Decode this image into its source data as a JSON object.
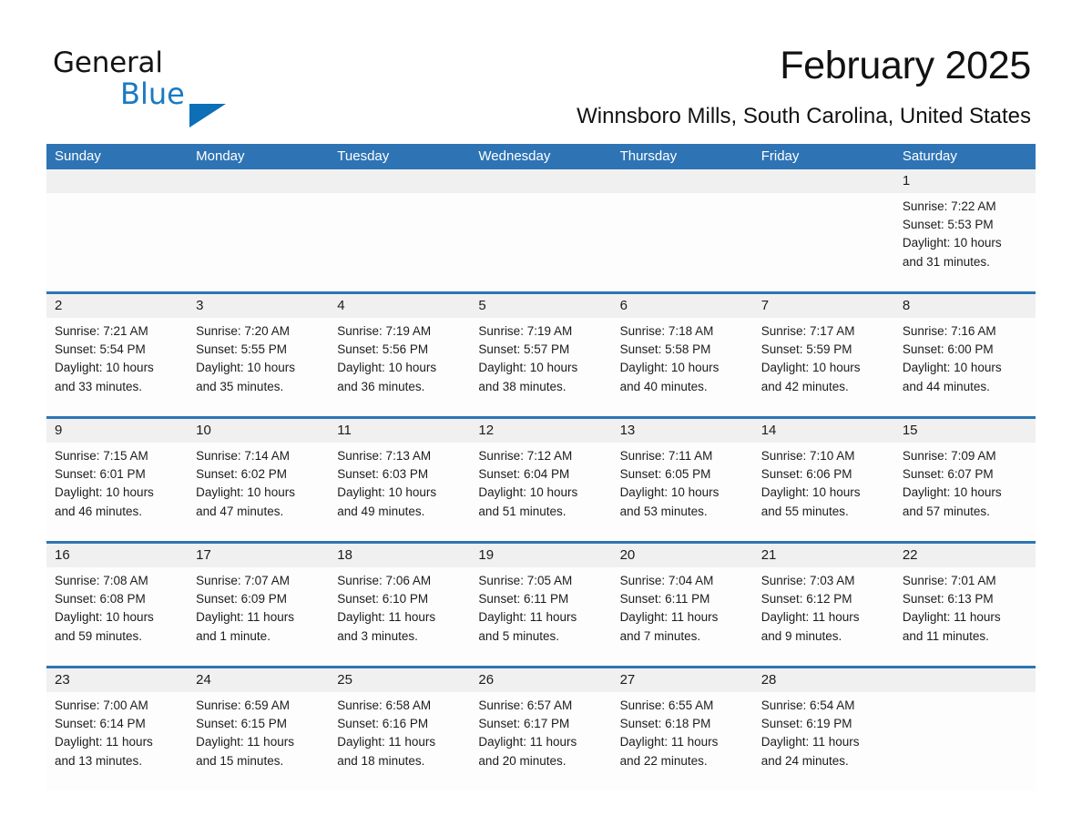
{
  "logo": {
    "line1": "General",
    "line2": "Blue",
    "triangle_color": "#0c6fb8",
    "line2_color": "#1a7ac4"
  },
  "header": {
    "title": "February 2025",
    "subtitle": "Winnsboro Mills, South Carolina, United States"
  },
  "theme": {
    "header_blue": "#2e74b5",
    "daynum_band": "#f0f0f0",
    "text": "#1c1c1c"
  },
  "weekdays": [
    "Sunday",
    "Monday",
    "Tuesday",
    "Wednesday",
    "Thursday",
    "Friday",
    "Saturday"
  ],
  "weeks": [
    [
      {
        "day": "",
        "sunrise": "",
        "sunset": "",
        "daylight_line1": "",
        "daylight_line2": ""
      },
      {
        "day": "",
        "sunrise": "",
        "sunset": "",
        "daylight_line1": "",
        "daylight_line2": ""
      },
      {
        "day": "",
        "sunrise": "",
        "sunset": "",
        "daylight_line1": "",
        "daylight_line2": ""
      },
      {
        "day": "",
        "sunrise": "",
        "sunset": "",
        "daylight_line1": "",
        "daylight_line2": ""
      },
      {
        "day": "",
        "sunrise": "",
        "sunset": "",
        "daylight_line1": "",
        "daylight_line2": ""
      },
      {
        "day": "",
        "sunrise": "",
        "sunset": "",
        "daylight_line1": "",
        "daylight_line2": ""
      },
      {
        "day": "1",
        "sunrise": "Sunrise: 7:22 AM",
        "sunset": "Sunset: 5:53 PM",
        "daylight_line1": "Daylight: 10 hours",
        "daylight_line2": "and 31 minutes."
      }
    ],
    [
      {
        "day": "2",
        "sunrise": "Sunrise: 7:21 AM",
        "sunset": "Sunset: 5:54 PM",
        "daylight_line1": "Daylight: 10 hours",
        "daylight_line2": "and 33 minutes."
      },
      {
        "day": "3",
        "sunrise": "Sunrise: 7:20 AM",
        "sunset": "Sunset: 5:55 PM",
        "daylight_line1": "Daylight: 10 hours",
        "daylight_line2": "and 35 minutes."
      },
      {
        "day": "4",
        "sunrise": "Sunrise: 7:19 AM",
        "sunset": "Sunset: 5:56 PM",
        "daylight_line1": "Daylight: 10 hours",
        "daylight_line2": "and 36 minutes."
      },
      {
        "day": "5",
        "sunrise": "Sunrise: 7:19 AM",
        "sunset": "Sunset: 5:57 PM",
        "daylight_line1": "Daylight: 10 hours",
        "daylight_line2": "and 38 minutes."
      },
      {
        "day": "6",
        "sunrise": "Sunrise: 7:18 AM",
        "sunset": "Sunset: 5:58 PM",
        "daylight_line1": "Daylight: 10 hours",
        "daylight_line2": "and 40 minutes."
      },
      {
        "day": "7",
        "sunrise": "Sunrise: 7:17 AM",
        "sunset": "Sunset: 5:59 PM",
        "daylight_line1": "Daylight: 10 hours",
        "daylight_line2": "and 42 minutes."
      },
      {
        "day": "8",
        "sunrise": "Sunrise: 7:16 AM",
        "sunset": "Sunset: 6:00 PM",
        "daylight_line1": "Daylight: 10 hours",
        "daylight_line2": "and 44 minutes."
      }
    ],
    [
      {
        "day": "9",
        "sunrise": "Sunrise: 7:15 AM",
        "sunset": "Sunset: 6:01 PM",
        "daylight_line1": "Daylight: 10 hours",
        "daylight_line2": "and 46 minutes."
      },
      {
        "day": "10",
        "sunrise": "Sunrise: 7:14 AM",
        "sunset": "Sunset: 6:02 PM",
        "daylight_line1": "Daylight: 10 hours",
        "daylight_line2": "and 47 minutes."
      },
      {
        "day": "11",
        "sunrise": "Sunrise: 7:13 AM",
        "sunset": "Sunset: 6:03 PM",
        "daylight_line1": "Daylight: 10 hours",
        "daylight_line2": "and 49 minutes."
      },
      {
        "day": "12",
        "sunrise": "Sunrise: 7:12 AM",
        "sunset": "Sunset: 6:04 PM",
        "daylight_line1": "Daylight: 10 hours",
        "daylight_line2": "and 51 minutes."
      },
      {
        "day": "13",
        "sunrise": "Sunrise: 7:11 AM",
        "sunset": "Sunset: 6:05 PM",
        "daylight_line1": "Daylight: 10 hours",
        "daylight_line2": "and 53 minutes."
      },
      {
        "day": "14",
        "sunrise": "Sunrise: 7:10 AM",
        "sunset": "Sunset: 6:06 PM",
        "daylight_line1": "Daylight: 10 hours",
        "daylight_line2": "and 55 minutes."
      },
      {
        "day": "15",
        "sunrise": "Sunrise: 7:09 AM",
        "sunset": "Sunset: 6:07 PM",
        "daylight_line1": "Daylight: 10 hours",
        "daylight_line2": "and 57 minutes."
      }
    ],
    [
      {
        "day": "16",
        "sunrise": "Sunrise: 7:08 AM",
        "sunset": "Sunset: 6:08 PM",
        "daylight_line1": "Daylight: 10 hours",
        "daylight_line2": "and 59 minutes."
      },
      {
        "day": "17",
        "sunrise": "Sunrise: 7:07 AM",
        "sunset": "Sunset: 6:09 PM",
        "daylight_line1": "Daylight: 11 hours",
        "daylight_line2": "and 1 minute."
      },
      {
        "day": "18",
        "sunrise": "Sunrise: 7:06 AM",
        "sunset": "Sunset: 6:10 PM",
        "daylight_line1": "Daylight: 11 hours",
        "daylight_line2": "and 3 minutes."
      },
      {
        "day": "19",
        "sunrise": "Sunrise: 7:05 AM",
        "sunset": "Sunset: 6:11 PM",
        "daylight_line1": "Daylight: 11 hours",
        "daylight_line2": "and 5 minutes."
      },
      {
        "day": "20",
        "sunrise": "Sunrise: 7:04 AM",
        "sunset": "Sunset: 6:11 PM",
        "daylight_line1": "Daylight: 11 hours",
        "daylight_line2": "and 7 minutes."
      },
      {
        "day": "21",
        "sunrise": "Sunrise: 7:03 AM",
        "sunset": "Sunset: 6:12 PM",
        "daylight_line1": "Daylight: 11 hours",
        "daylight_line2": "and 9 minutes."
      },
      {
        "day": "22",
        "sunrise": "Sunrise: 7:01 AM",
        "sunset": "Sunset: 6:13 PM",
        "daylight_line1": "Daylight: 11 hours",
        "daylight_line2": "and 11 minutes."
      }
    ],
    [
      {
        "day": "23",
        "sunrise": "Sunrise: 7:00 AM",
        "sunset": "Sunset: 6:14 PM",
        "daylight_line1": "Daylight: 11 hours",
        "daylight_line2": "and 13 minutes."
      },
      {
        "day": "24",
        "sunrise": "Sunrise: 6:59 AM",
        "sunset": "Sunset: 6:15 PM",
        "daylight_line1": "Daylight: 11 hours",
        "daylight_line2": "and 15 minutes."
      },
      {
        "day": "25",
        "sunrise": "Sunrise: 6:58 AM",
        "sunset": "Sunset: 6:16 PM",
        "daylight_line1": "Daylight: 11 hours",
        "daylight_line2": "and 18 minutes."
      },
      {
        "day": "26",
        "sunrise": "Sunrise: 6:57 AM",
        "sunset": "Sunset: 6:17 PM",
        "daylight_line1": "Daylight: 11 hours",
        "daylight_line2": "and 20 minutes."
      },
      {
        "day": "27",
        "sunrise": "Sunrise: 6:55 AM",
        "sunset": "Sunset: 6:18 PM",
        "daylight_line1": "Daylight: 11 hours",
        "daylight_line2": "and 22 minutes."
      },
      {
        "day": "28",
        "sunrise": "Sunrise: 6:54 AM",
        "sunset": "Sunset: 6:19 PM",
        "daylight_line1": "Daylight: 11 hours",
        "daylight_line2": "and 24 minutes."
      },
      {
        "day": "",
        "sunrise": "",
        "sunset": "",
        "daylight_line1": "",
        "daylight_line2": ""
      }
    ]
  ]
}
